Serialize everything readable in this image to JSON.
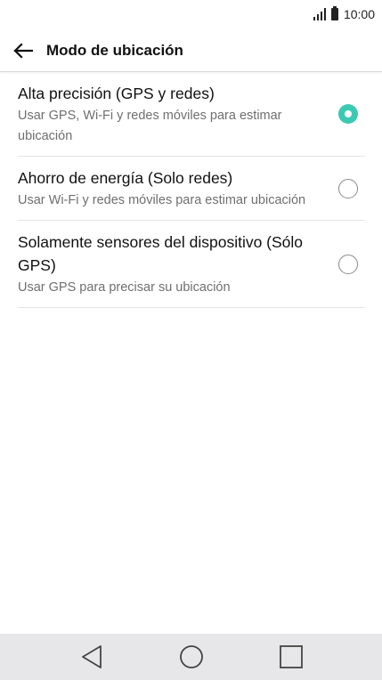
{
  "status_bar": {
    "time": "10:00",
    "signal_icon": "signal-icon",
    "battery_icon": "battery-icon"
  },
  "header": {
    "back_icon": "arrow-left-icon",
    "title": "Modo de ubicación"
  },
  "options": [
    {
      "title": "Alta precisión (GPS y redes)",
      "subtitle": "Usar GPS, Wi-Fi y redes móviles para estimar ubicación",
      "selected": true
    },
    {
      "title": "Ahorro de energía (Solo redes)",
      "subtitle": "Usar Wi-Fi y redes móviles para estimar ubicación",
      "selected": false
    },
    {
      "title": "Solamente sensores del dispositivo (Sólo GPS)",
      "subtitle": "Usar GPS para precisar su ubicación",
      "selected": false
    }
  ],
  "nav_bar": {
    "back_icon": "triangle-back-icon",
    "home_icon": "circle-home-icon",
    "recents_icon": "square-recents-icon"
  },
  "colors": {
    "accent": "#3cc9b1",
    "nav_background": "#e7e7e9"
  }
}
